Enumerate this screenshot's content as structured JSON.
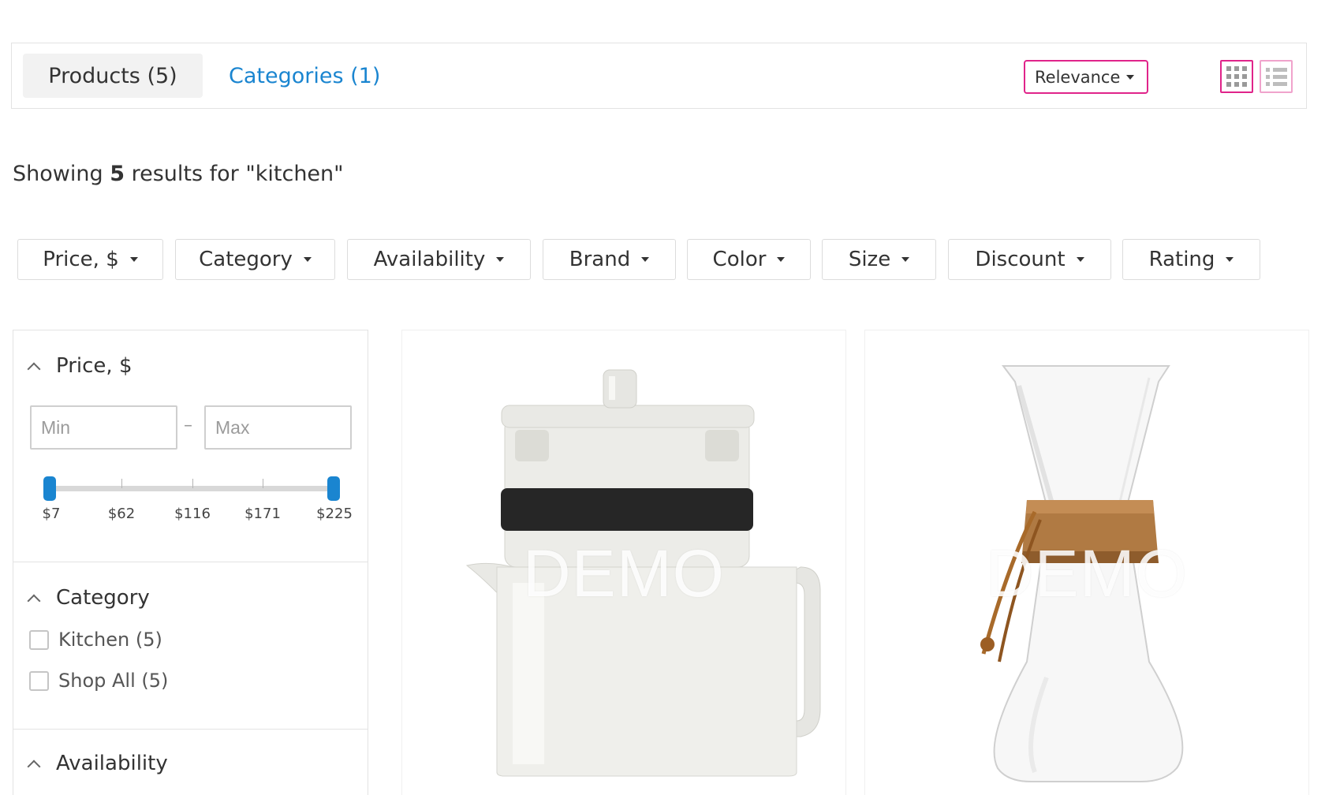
{
  "tabs": {
    "products": "Products (5)",
    "categories": "Categories (1)"
  },
  "sort": {
    "selected": "Relevance"
  },
  "view_modes": {
    "grid_icon": "grid-icon",
    "list_icon": "list-icon"
  },
  "results": {
    "prefix": "Showing",
    "count": "5",
    "suffix": "results for \"kitchen\""
  },
  "filter_chips": [
    "Price, $",
    "Category",
    "Availability",
    "Brand",
    "Color",
    "Size",
    "Discount",
    "Rating"
  ],
  "sidebar": {
    "price": {
      "title": "Price, $",
      "min_placeholder": "Min",
      "max_placeholder": "Max",
      "separator": "–",
      "ticks": [
        "$7",
        "$62",
        "$116",
        "$171",
        "$225"
      ]
    },
    "category": {
      "title": "Category",
      "options": [
        "Kitchen (5)",
        "Shop All (5)"
      ]
    },
    "availability": {
      "title": "Availability"
    }
  },
  "products": [
    {
      "watermark": "DEMO",
      "image": "teapot"
    },
    {
      "watermark": "DEMO",
      "image": "pour-over-coffee-maker"
    }
  ],
  "colors": {
    "accent": "#1a85d0",
    "highlight": "#e0248a"
  }
}
